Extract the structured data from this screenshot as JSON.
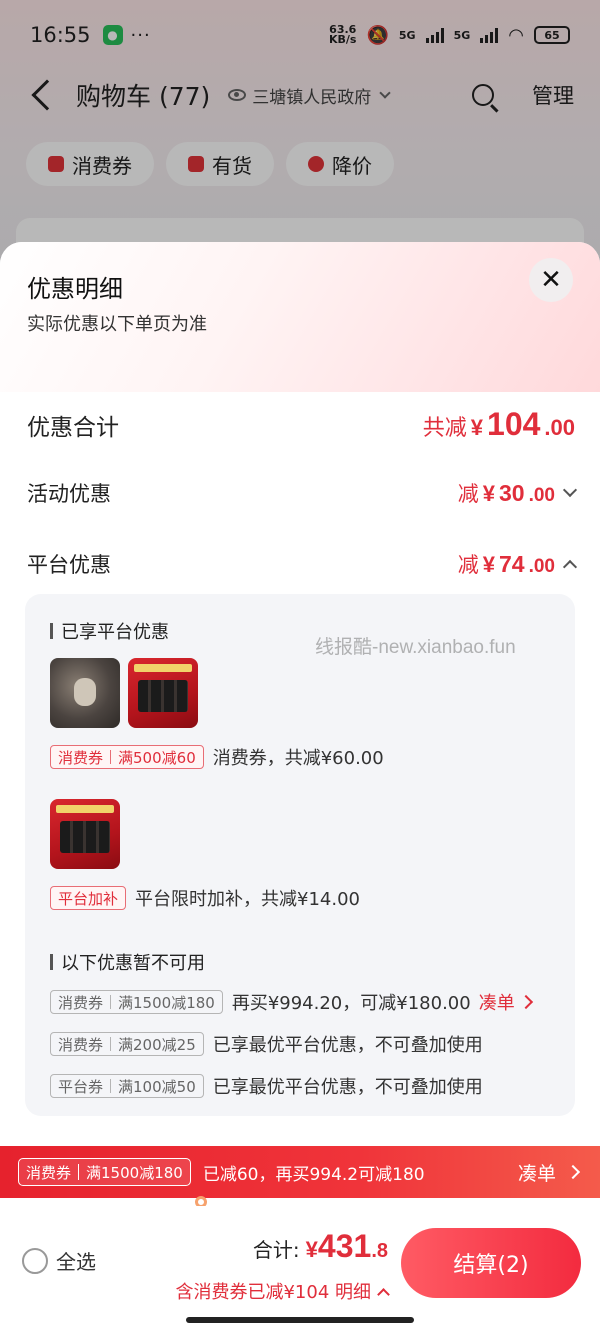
{
  "status_bar": {
    "time": "16:55",
    "dots": "···",
    "net_speed_value": "63.6",
    "net_speed_unit": "KB/s",
    "signal1": "5G",
    "signal2": "5G",
    "battery": "65"
  },
  "nav": {
    "title": "购物车 (77)",
    "address": "三塘镇人民政府",
    "manage_label": "管理"
  },
  "filter_chips": [
    {
      "label": "消费券"
    },
    {
      "label": "有货"
    },
    {
      "label": "降价"
    }
  ],
  "sheet": {
    "title": "优惠明细",
    "subtitle": "实际优惠以下单页为准",
    "close_glyph": "✕",
    "total": {
      "label": "优惠合计",
      "prefix": "共减",
      "yen": "¥",
      "int": "104",
      "dec": ".00"
    },
    "activity": {
      "label": "活动优惠",
      "prefix": "减",
      "yen": "¥",
      "int": "30",
      "dec": ".00"
    },
    "platform": {
      "label": "平台优惠",
      "prefix": "减",
      "yen": "¥",
      "int": "74",
      "dec": ".00"
    },
    "watermark": "线报酷-new.xianbao.fun",
    "enjoyed_title": "已享平台优惠",
    "coupon1": {
      "tag_left": "消费券",
      "tag_right": "满500减60",
      "text": "消费券，共减¥60.00"
    },
    "coupon2": {
      "tag": "平台加补",
      "text": "平台限时加补，共减¥14.00"
    },
    "unavailable_title": "以下优惠暂不可用",
    "unavailable": [
      {
        "tag_left": "消费券",
        "tag_right": "满1500减180",
        "text": "再买¥994.20，可减¥180.00",
        "link": "凑单"
      },
      {
        "tag_left": "消费券",
        "tag_right": "满200减25",
        "text": "已享最优平台优惠，不可叠加使用"
      },
      {
        "tag_left": "平台券",
        "tag_right": "满100减50",
        "text": "已享最优平台优惠，不可叠加使用"
      }
    ]
  },
  "strip": {
    "tag_left": "消费券",
    "tag_right": "满1500减180",
    "message": "已减60，再买994.2可减180",
    "link": "凑单"
  },
  "bottom_bar": {
    "select_all": "全选",
    "total_label": "合计:",
    "total_yen": "¥",
    "total_int": "431",
    "total_dec": ".8",
    "saved_text": "含消费券已减¥104 明细",
    "checkout_label": "结算(2)"
  },
  "colors": {
    "accent": "#e02e3b",
    "checkout": "#f32b3f"
  }
}
